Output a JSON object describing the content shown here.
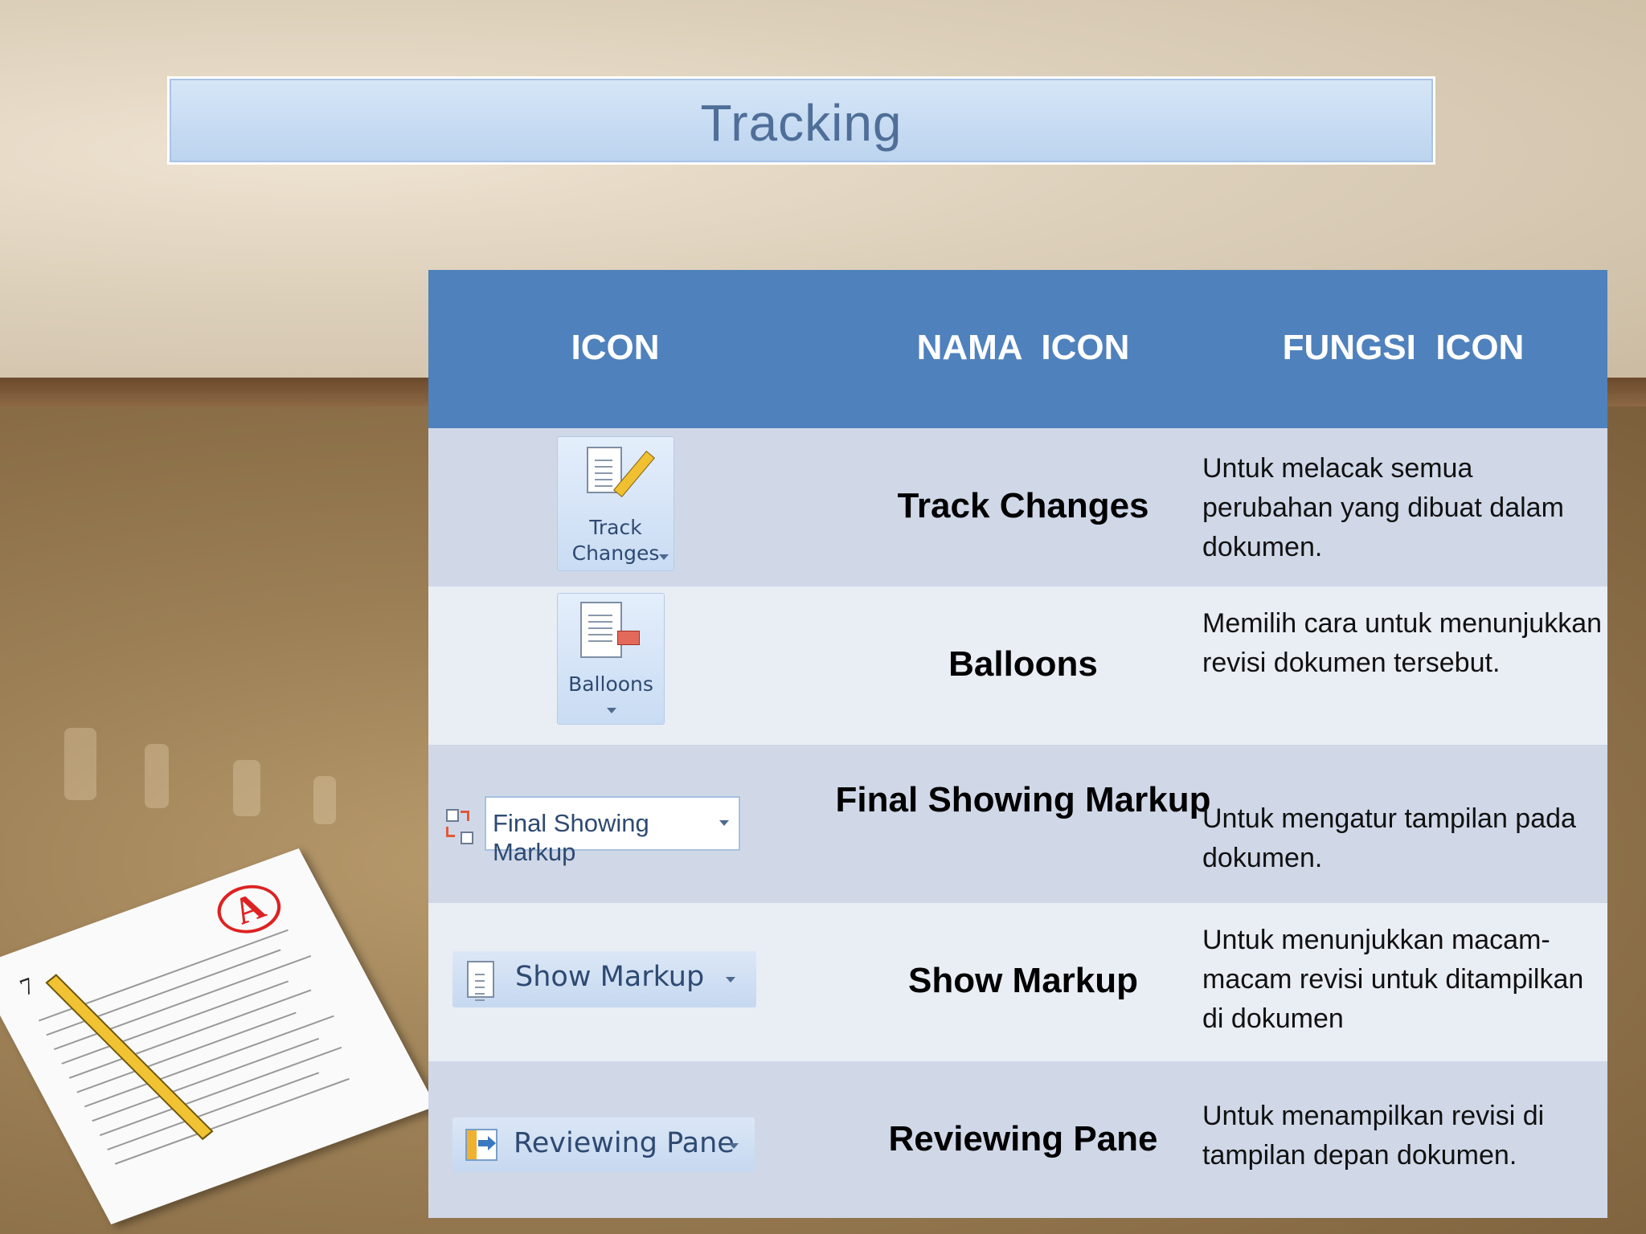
{
  "slide": {
    "title": "Tracking"
  },
  "table": {
    "headers": [
      "ICON",
      "NAMA  ICON",
      "FUNGSI  ICON"
    ],
    "rows": [
      {
        "icon_label_line1": "Track",
        "icon_label_line2": "Changes",
        "name": "Track Changes",
        "function": "Untuk melacak semua perubahan yang dibuat dalam dokumen."
      },
      {
        "icon_label_line1": "Balloons",
        "name": "Balloons",
        "function": "Memilih cara untuk menunjukkan revisi dokumen tersebut."
      },
      {
        "icon_label_line1": "Final Showing Markup",
        "name": "Final Showing Markup",
        "function": "Untuk mengatur tampilan pada dokumen."
      },
      {
        "icon_label_line1": "Show Markup",
        "name": "Show Markup",
        "function": "Untuk menunjukkan macam-macam revisi untuk ditampilkan di dokumen"
      },
      {
        "icon_label_line1": "Reviewing Pane",
        "name": "Reviewing Pane",
        "function": "Untuk menampilkan revisi di tampilan depan dokumen."
      }
    ]
  },
  "decor": {
    "paper_grade": "A",
    "paper_number": "7"
  }
}
